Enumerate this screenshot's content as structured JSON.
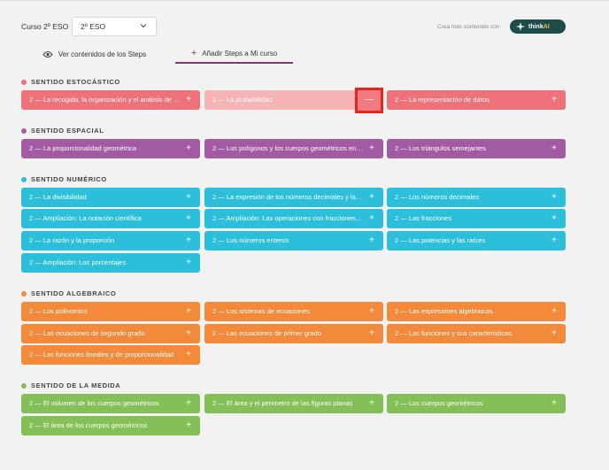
{
  "header": {
    "course_label": "Curso 2º ESO",
    "course_value": "2º ESO",
    "think_prompt": "Crea más contenido con",
    "think_brand_a": "think",
    "think_brand_b": "AI"
  },
  "tabs": [
    {
      "label": "Ver contenidos de los Steps",
      "icon": "eye-icon"
    },
    {
      "label": "Añadir Steps a Mi curso",
      "icon": "plus-icon",
      "active": true
    }
  ],
  "sections": [
    {
      "title": "SENTIDO ESTOCÁSTICO",
      "color": "#ef7179",
      "cards": [
        {
          "label": "2 — La recogida, la organización y el análisis de los datos",
          "action": "+"
        },
        {
          "label": "2 — La probabilidad",
          "action": "—",
          "state": "added"
        },
        {
          "label": "2 — La representación de datos",
          "action": "+"
        }
      ]
    },
    {
      "title": "SENTIDO ESPACIAL",
      "color": "#a25ba3",
      "cards": [
        {
          "label": "2 — La proporcionalidad geométrica",
          "action": "+"
        },
        {
          "label": "2 — Los polígonos y los cuerpos geométricos en el espacio",
          "action": "+"
        },
        {
          "label": "2 — Los triángulos semejantes",
          "action": "+"
        }
      ]
    },
    {
      "title": "SENTIDO NUMÉRICO",
      "color": "#2cbfdc",
      "cards": [
        {
          "label": "2 — La divisibilidad",
          "action": "+"
        },
        {
          "label": "2 — La expresión de los números decimales y las fracciones",
          "action": "+"
        },
        {
          "label": "2 — Los números decimales",
          "action": "+"
        },
        {
          "label": "2 — Ampliación: La notación científica",
          "action": "+"
        },
        {
          "label": "2 — Ampliación: Las operaciones con fracciones decimales",
          "action": "+"
        },
        {
          "label": "2 — Las fracciones",
          "action": "+"
        },
        {
          "label": "2 — La razón y la proporción",
          "action": "+"
        },
        {
          "label": "2 — Los números enteros",
          "action": "+"
        },
        {
          "label": "2 — Las potencias y las raíces",
          "action": "+"
        },
        {
          "label": "2 — Ampliación: Los porcentajes",
          "action": "+"
        }
      ]
    },
    {
      "title": "SENTIDO ALGEBRAICO",
      "color": "#f38a3b",
      "cards": [
        {
          "label": "2 — Los polinomios",
          "action": "+"
        },
        {
          "label": "2 — Los sistemas de ecuaciones",
          "action": "+"
        },
        {
          "label": "2 — Las expresiones algebraicas",
          "action": "+"
        },
        {
          "label": "2 — Las ecuaciones de segundo grado",
          "action": "+"
        },
        {
          "label": "2 — Las ecuaciones de primer grado",
          "action": "+"
        },
        {
          "label": "2 — Las funciones y sus características",
          "action": "+"
        },
        {
          "label": "2 — Las funciones lineales y de proporcionalidad",
          "action": "+"
        }
      ]
    },
    {
      "title": "SENTIDO DE LA MEDIDA",
      "color": "#84bf58",
      "cards": [
        {
          "label": "2 — El volumen de los cuerpos geométricos",
          "action": "+"
        },
        {
          "label": "2 — El área y el perímetro de las figuras planas",
          "action": "+"
        },
        {
          "label": "2 — Los cuerpos geométricos",
          "action": "+"
        },
        {
          "label": "2 — El área de los cuerpos geométricos",
          "action": "+"
        }
      ]
    }
  ]
}
